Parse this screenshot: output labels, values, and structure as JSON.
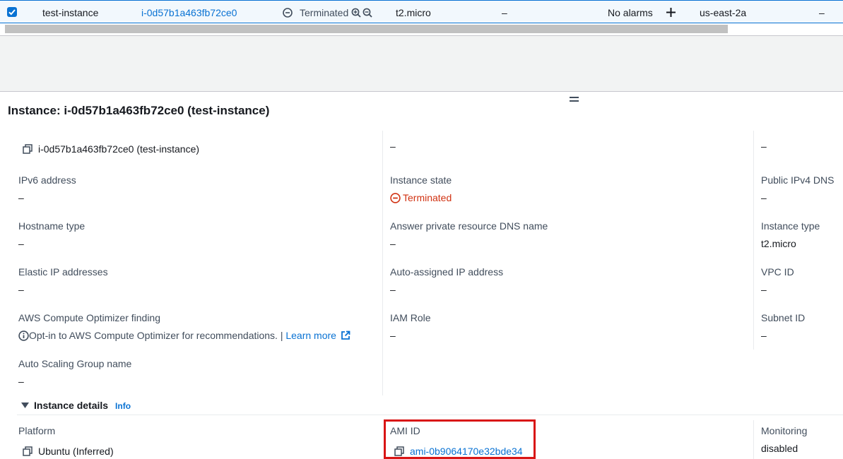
{
  "row": {
    "checked": true,
    "name": "test-instance",
    "instance_id": "i-0d57b1a463fb72ce0",
    "state": "Terminated",
    "instance_type": "t2.micro",
    "status_check": "–",
    "alarm_status": "No alarms",
    "availability_zone": "us-east-2a",
    "public_dns": "–"
  },
  "panel": {
    "title": "Instance: i-0d57b1a463fb72ce0 (test-instance)"
  },
  "summary": {
    "col1": [
      {
        "value": "i-0d57b1a463fb72ce0 (test-instance)"
      },
      {
        "label": "IPv6 address",
        "value": "–"
      },
      {
        "label": "Hostname type",
        "value": "–"
      },
      {
        "label": "Elastic IP addresses",
        "value": "–"
      },
      {
        "label": "AWS Compute Optimizer finding",
        "value": "Opt-in to AWS Compute Optimizer for recommendations. |",
        "link": "Learn more"
      },
      {
        "label": "Auto Scaling Group name",
        "value": "–"
      }
    ],
    "col2": [
      {
        "value": "–"
      },
      {
        "label": "Instance state",
        "value": "Terminated"
      },
      {
        "label": "Answer private resource DNS name",
        "value": "–"
      },
      {
        "label": "Auto-assigned IP address",
        "value": "–"
      },
      {
        "label": "IAM Role",
        "value": "–"
      }
    ],
    "col3": [
      {
        "value": "–"
      },
      {
        "label": "Public IPv4 DNS",
        "value": "–"
      },
      {
        "label": "Instance type",
        "value": "t2.micro"
      },
      {
        "label": "VPC ID",
        "value": "–"
      },
      {
        "label": "Subnet ID",
        "value": "–"
      }
    ]
  },
  "instance_details": {
    "title": "Instance details",
    "info": "Info",
    "platform_label": "Platform",
    "platform_value": "Ubuntu (Inferred)",
    "ami_label": "AMI ID",
    "ami_value": "ami-0b9064170e32bde34",
    "monitoring_label": "Monitoring",
    "monitoring_value": "disabled"
  },
  "colors": {
    "link": "#0972d3",
    "terminated": "#d13212",
    "highlight": "#d91515",
    "selected_row_bg": "#f2f8fd"
  }
}
